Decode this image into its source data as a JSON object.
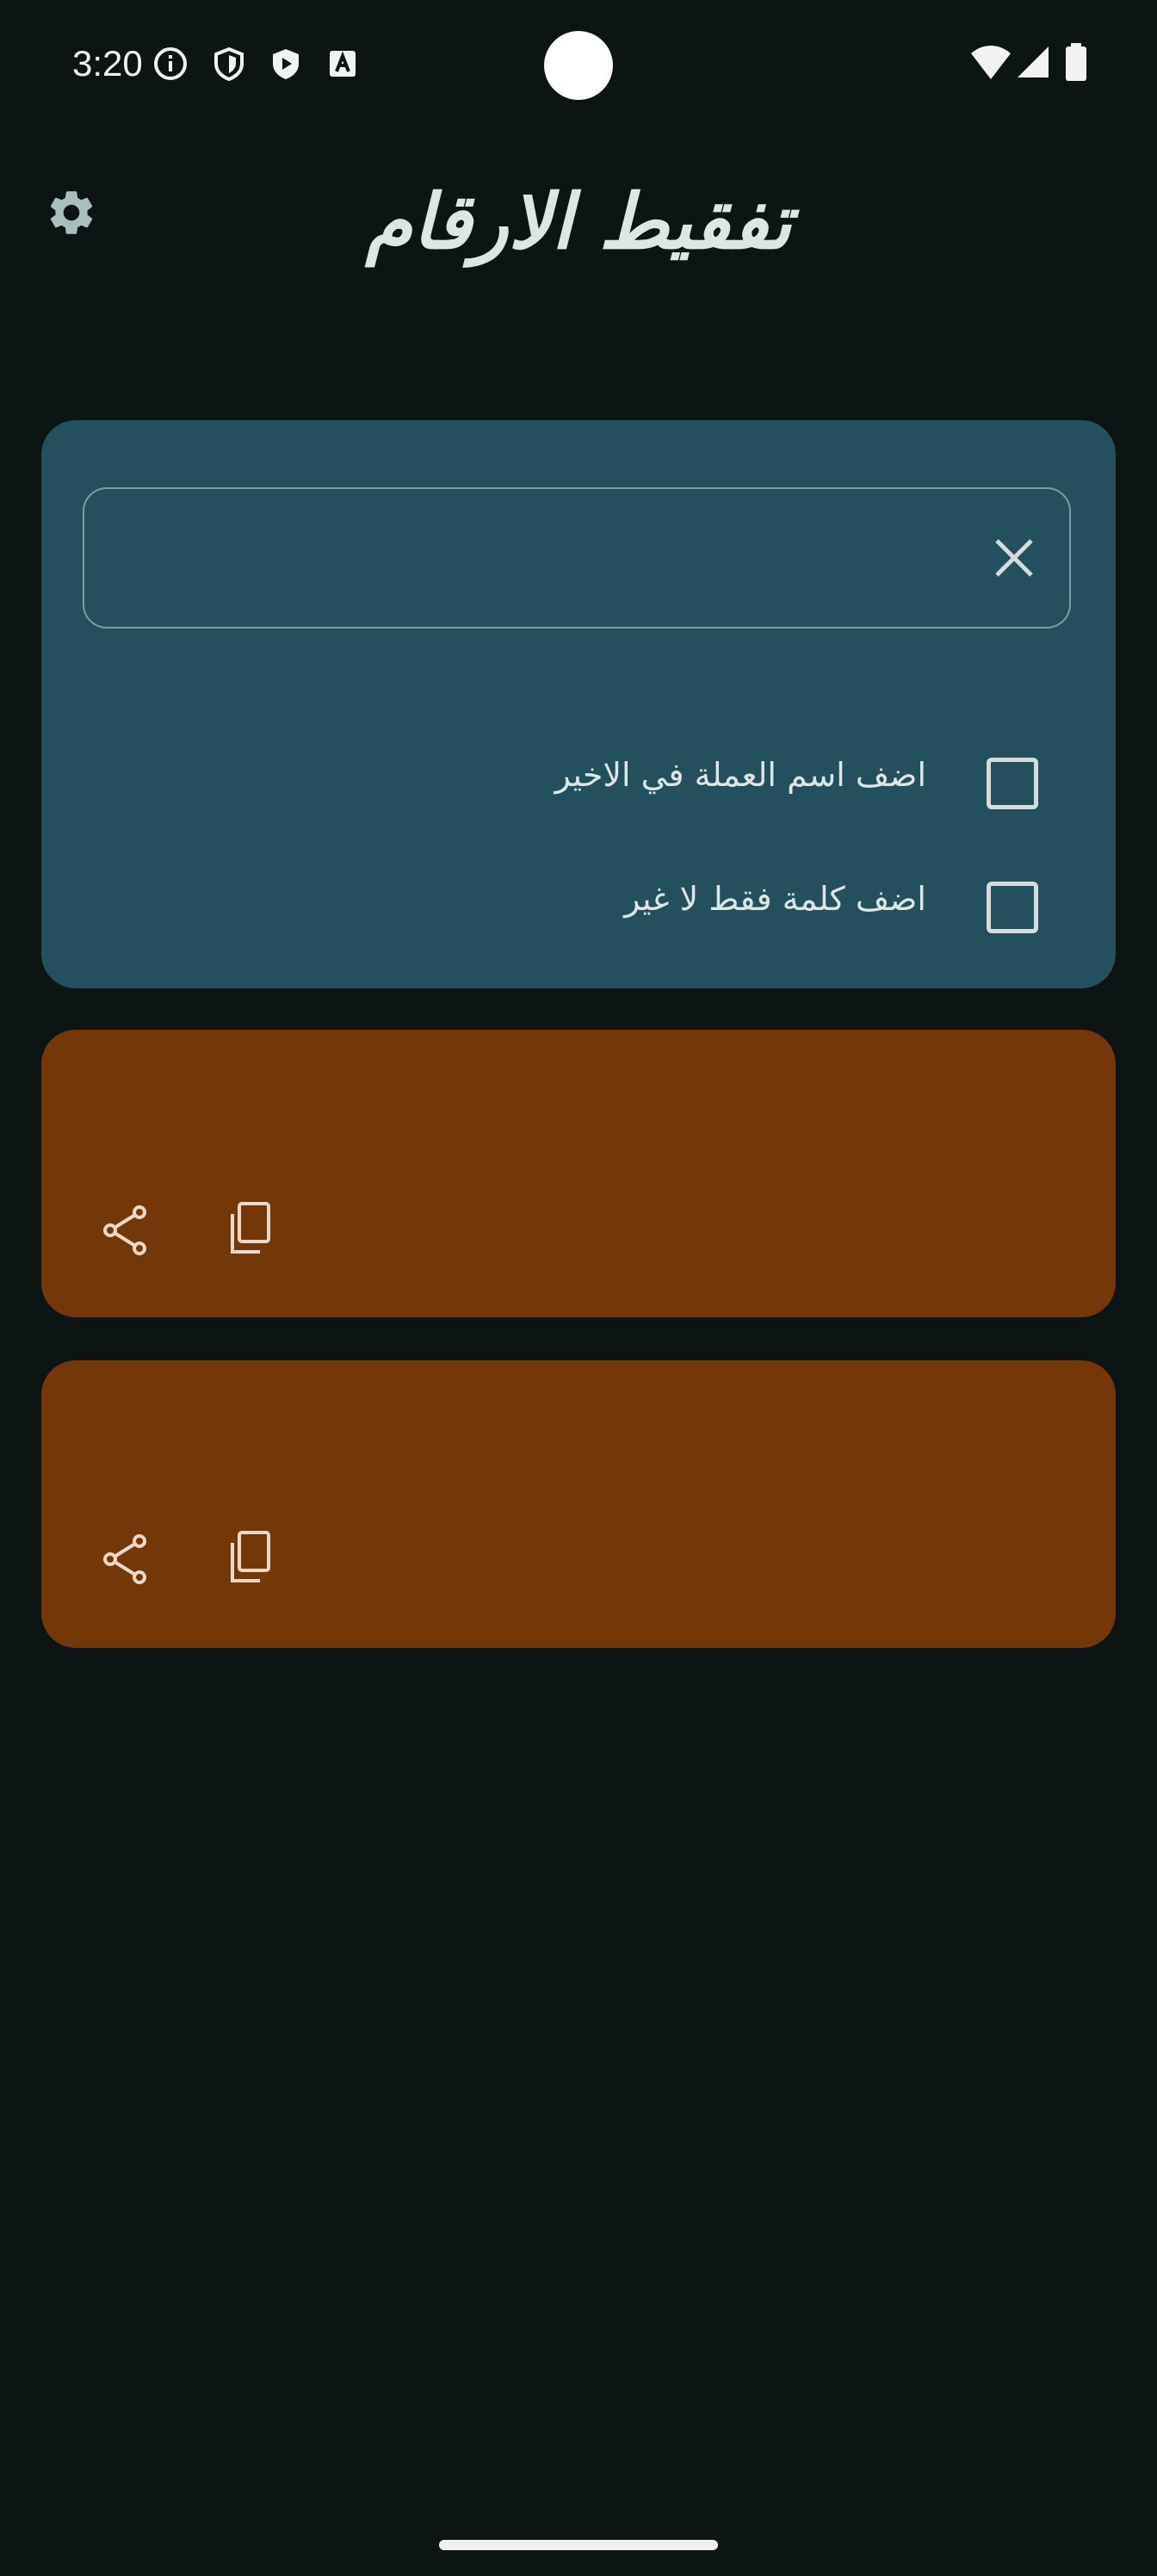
{
  "status_bar": {
    "time": "3:20",
    "icons": [
      "info-icon",
      "shield-icon",
      "play-protect-icon",
      "font-a-icon"
    ],
    "right_icons": [
      "wifi-icon",
      "cell-signal-icon",
      "battery-icon"
    ]
  },
  "header": {
    "title": "تفقيط الارقام",
    "settings_icon": "gear-icon"
  },
  "input_card": {
    "field_value": "",
    "field_placeholder": "",
    "clear_icon": "close-icon",
    "options": [
      {
        "label": "اضف اسم العملة في الاخير",
        "checked": false
      },
      {
        "label": "اضف كلمة فقط لا غير",
        "checked": false
      }
    ]
  },
  "result_cards": [
    {
      "text": "",
      "actions": [
        "share-icon",
        "copy-icon"
      ]
    },
    {
      "text": "",
      "actions": [
        "share-icon",
        "copy-icon"
      ]
    }
  ],
  "colors": {
    "background": "#0d1414",
    "input_card": "#244f5c",
    "result_card": "#733708",
    "accent_text": "#dce6e2"
  }
}
